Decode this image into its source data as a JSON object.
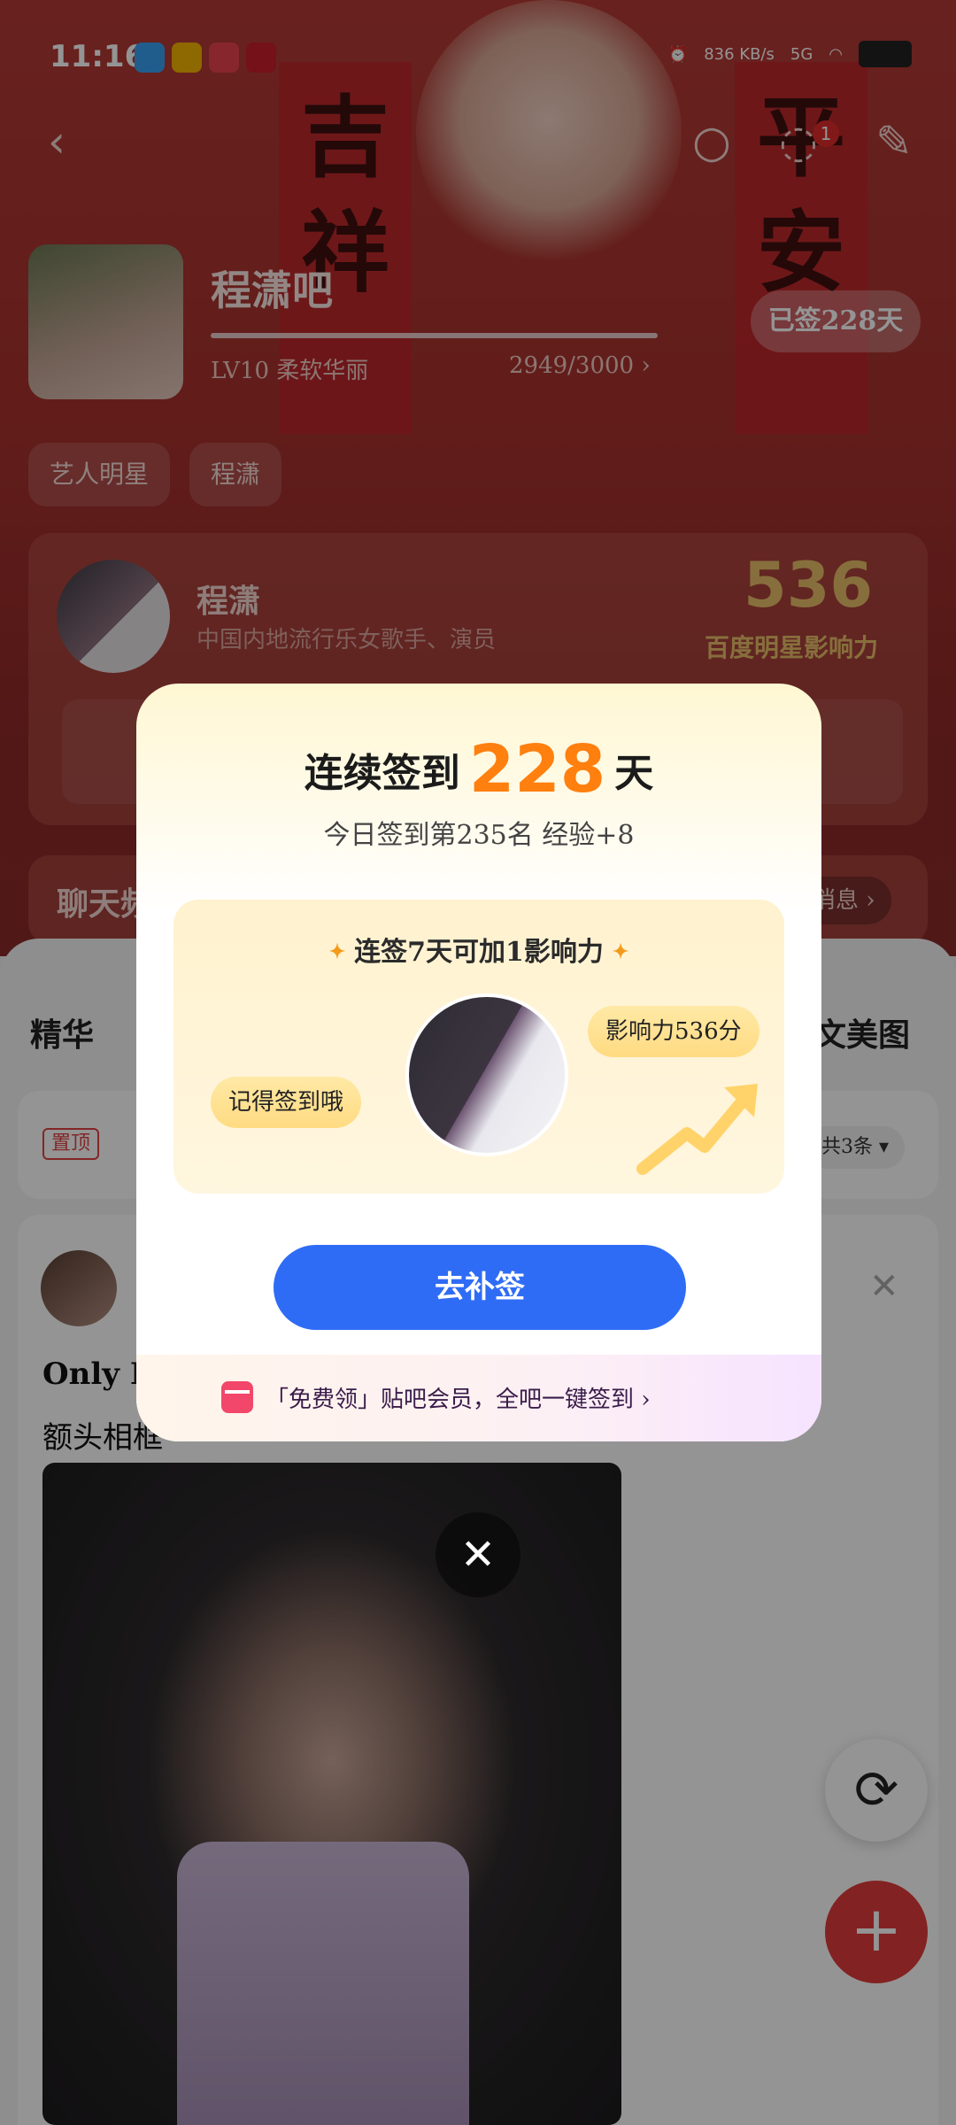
{
  "status_bar": {
    "time": "11:16",
    "net_speed": "836 KB/s",
    "signal": "5G"
  },
  "hero": {
    "banner_left": "吉祥",
    "banner_right": "平安",
    "notification_count": "1"
  },
  "forum": {
    "name": "程潇吧",
    "level": "LV10 柔软华丽",
    "exp": "2949/3000 ›",
    "signed_days": "已签228天",
    "tags": [
      "艺人明星",
      "程潇"
    ]
  },
  "star": {
    "name": "程潇",
    "desc": "中国内地流行乐女歌手、演员",
    "score": "536",
    "score_label": "百度明星影响力"
  },
  "chat": {
    "title": "聊天频",
    "msg": "消息 ›"
  },
  "tabs": {
    "left": "精华",
    "right": "文美图"
  },
  "pinned": {
    "badge": "置顶",
    "count": "共3条 ▾"
  },
  "post": {
    "line1": "Only F",
    "line2": "额头相框"
  },
  "modal": {
    "title_prefix": "连续签到",
    "days": "228",
    "title_suffix": "天",
    "subtitle": "今日签到第235名 经验+8",
    "reward_head": "连签7天可加1影响力",
    "bubble_left": "记得签到哦",
    "bubble_right": "影响力536分",
    "cta": "去补签",
    "footer": "「免费领」贴吧会员，全吧一键签到 ›"
  }
}
